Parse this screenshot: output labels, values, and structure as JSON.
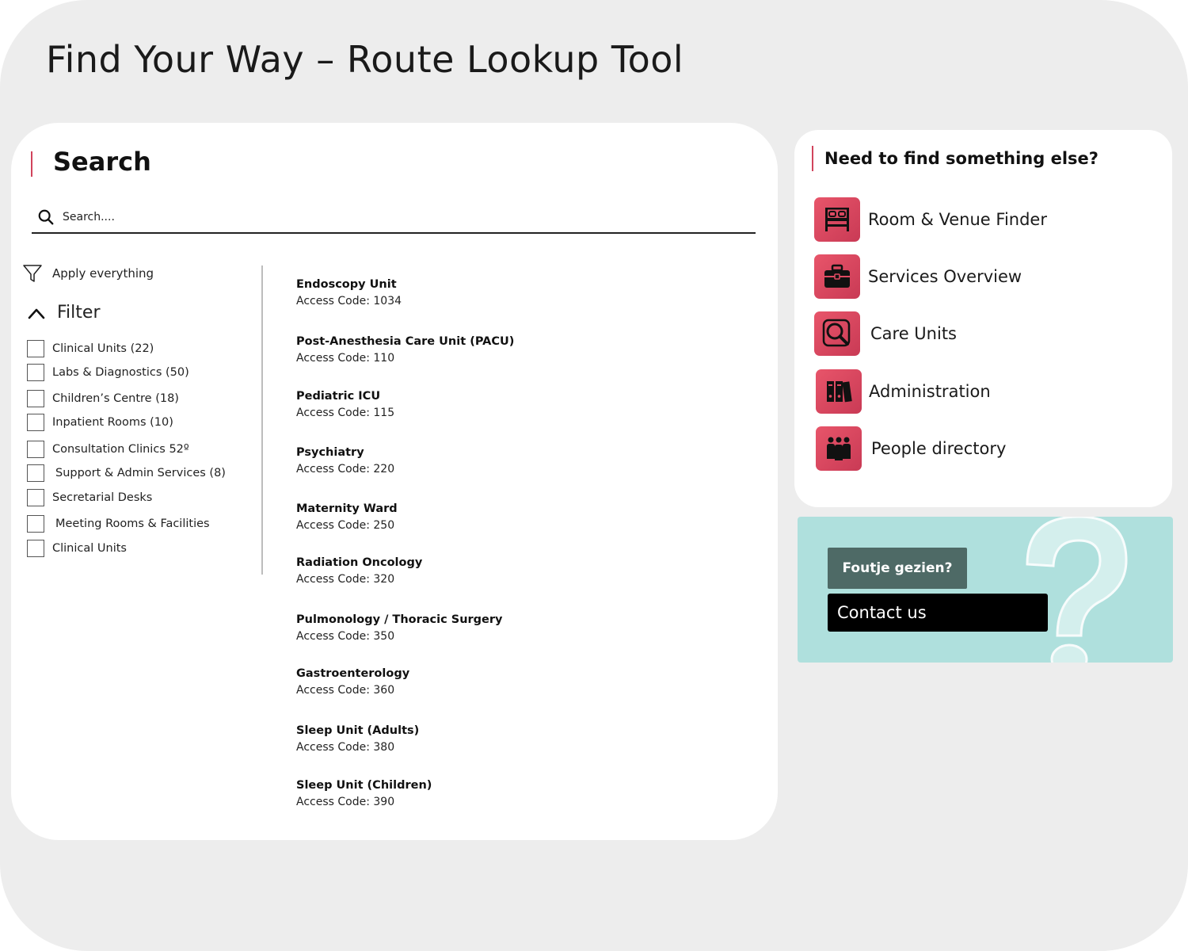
{
  "page": {
    "title": "Find Your Way – Route Lookup Tool"
  },
  "search": {
    "heading": "Search",
    "placeholder": "Search....",
    "value": ""
  },
  "filters": {
    "apply_label": "Apply everything",
    "toggle_label": "Filter",
    "expanded": true,
    "items": [
      {
        "label": "Clinical Units (22)",
        "checked": false
      },
      {
        "label": "Labs & Diagnostics (50)",
        "checked": false
      },
      {
        "label": "Children’s Centre (18)",
        "checked": false
      },
      {
        "label": "Inpatient Rooms (10)",
        "checked": false
      },
      {
        "label": "Consultation Clinics 52º",
        "checked": false
      },
      {
        "label": "Support & Admin Services (8)",
        "checked": false
      },
      {
        "label": "Secretarial Desks",
        "checked": false
      },
      {
        "label": "Meeting Rooms & Facilities",
        "checked": false
      },
      {
        "label": "Clinical Units",
        "checked": false
      }
    ]
  },
  "results": [
    {
      "name": "Endoscopy Unit",
      "code": "Access Code: 1034"
    },
    {
      "name": "Post-Anesthesia Care Unit (PACU)",
      "code": "Access Code: 110"
    },
    {
      "name": "Pediatric ICU",
      "code": "Access Code: 115"
    },
    {
      "name": "Psychiatry",
      "code": "Access Code: 220"
    },
    {
      "name": "Maternity Ward",
      "code": "Access Code: 250"
    },
    {
      "name": "Radiation Oncology",
      "code": "Access Code: 320"
    },
    {
      "name": "Pulmonology / Thoracic Surgery",
      "code": "Access Code: 350"
    },
    {
      "name": "Gastroenterology",
      "code": "Access Code: 360"
    },
    {
      "name": "Sleep Unit (Adults)",
      "code": "Access Code: 380"
    },
    {
      "name": "Sleep Unit (Children)",
      "code": "Access Code: 390"
    }
  ],
  "quick_links": {
    "heading": "Need to find something else?",
    "items": [
      {
        "label": "Room & Venue Finder",
        "icon": "bed-icon"
      },
      {
        "label": "Services Overview",
        "icon": "briefcase-icon"
      },
      {
        "label": "Care Units",
        "icon": "magnifier-icon"
      },
      {
        "label": "Administration",
        "icon": "binders-icon"
      },
      {
        "label": "People directory",
        "icon": "people-icon"
      }
    ]
  },
  "feedback": {
    "tag_label": "Foutje gezien?",
    "contact_label": "Contact us"
  },
  "colors": {
    "accent": "#d1445c",
    "icon_tile": "#e04a62",
    "banner": "#afe0dd",
    "tag_button": "#4e6a66",
    "contact_button": "#000000",
    "page_background": "#ededed"
  }
}
